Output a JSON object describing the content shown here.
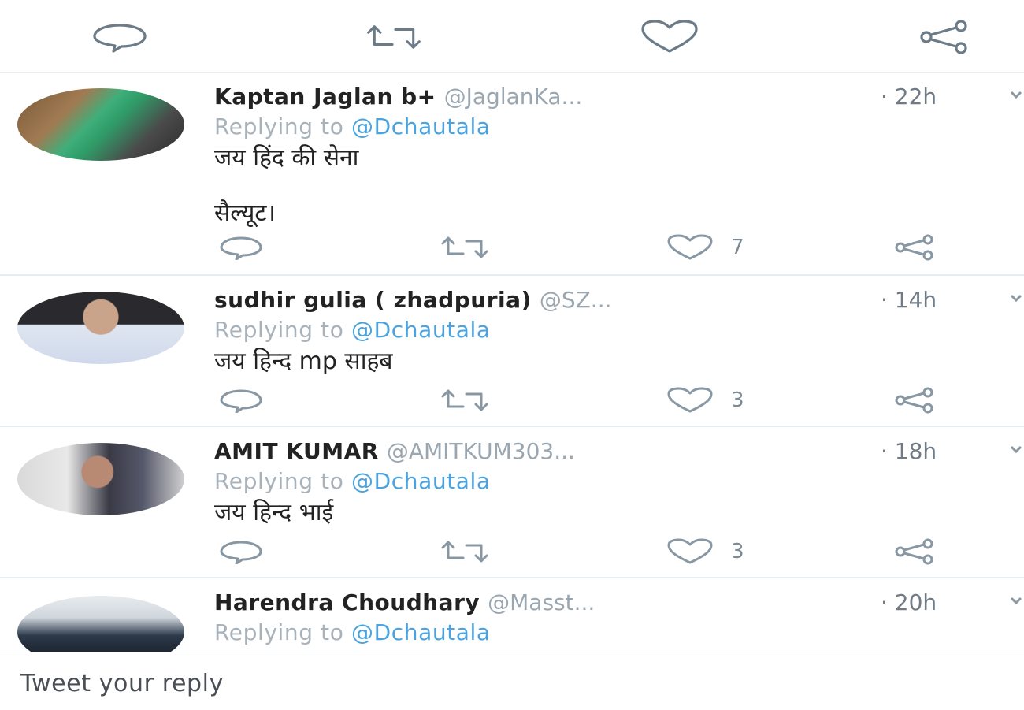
{
  "top_actions": {
    "reply_icon": "reply-icon",
    "retweet_icon": "retweet-icon",
    "like_icon": "like-icon",
    "share_icon": "share-icon"
  },
  "tweets": [
    {
      "name": "Kaptan Jaglan b+",
      "handle": "@JaglanKa...",
      "time": "· 22h",
      "replying_prefix": "Replying to",
      "replying_to": "@Dchautala",
      "text_line1": "जय हिंद की सेना",
      "text_line2": "सैल्यूट।",
      "likes": "7"
    },
    {
      "name": "sudhir gulia ( zhadpuria)",
      "handle": "@SZ...",
      "time": "· 14h",
      "replying_prefix": "Replying to",
      "replying_to": "@Dchautala",
      "text_line1": "जय हिन्द mp साहब",
      "likes": "3"
    },
    {
      "name": "AMIT KUMAR",
      "handle": "@AMITKUM303...",
      "time": "· 18h",
      "replying_prefix": "Replying to",
      "replying_to": "@Dchautala",
      "text_line1": "जय हिन्द भाई",
      "likes": "3"
    },
    {
      "name": "Harendra Choudhary",
      "handle": "@Masst...",
      "time": "· 20h",
      "replying_prefix": "Replying to",
      "replying_to": "@Dchautala"
    }
  ],
  "reply_bar": {
    "placeholder": "Tweet your reply"
  }
}
